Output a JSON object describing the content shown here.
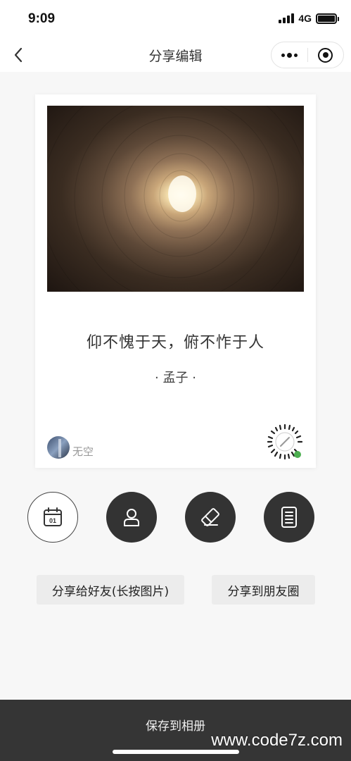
{
  "status_bar": {
    "time": "9:09",
    "network": "4G",
    "icons": [
      "signal-icon",
      "battery-icon"
    ]
  },
  "nav": {
    "title": "分享编辑",
    "icons": [
      "back-icon",
      "more-icon",
      "target-icon"
    ]
  },
  "card": {
    "image": "tunnel-light-photo",
    "quote": "仰不愧于天，俯不怍于人",
    "author": "· 孟子 ·",
    "username": "无空",
    "qr_icon": "mini-program-code-icon"
  },
  "actions": [
    {
      "name": "calendar",
      "icon": "calendar-icon",
      "day": "01",
      "style": "outlined"
    },
    {
      "name": "user",
      "icon": "user-icon",
      "style": "filled"
    },
    {
      "name": "eraser",
      "icon": "eraser-icon",
      "style": "filled"
    },
    {
      "name": "document",
      "icon": "document-icon",
      "style": "filled"
    }
  ],
  "share": {
    "friend_label": "分享给好友(长按图片)",
    "moments_label": "分享到朋友圈"
  },
  "bottom": {
    "save_label": "保存到相册"
  },
  "watermark": "www.code7z.com",
  "colors": {
    "button_dark": "#333333",
    "bottom_bar": "#353535",
    "share_button_bg": "#ececec",
    "page_bg": "#f7f7f7"
  }
}
